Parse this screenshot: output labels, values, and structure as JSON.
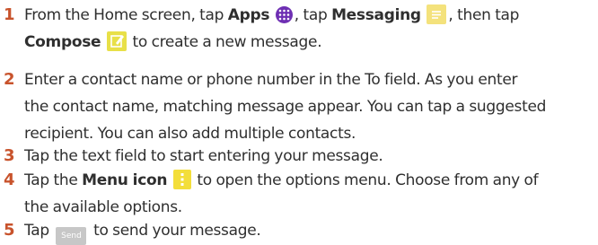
{
  "steps": [
    {
      "num": "1",
      "lines": [
        [
          "From the Home screen, tap ",
          "Apps",
          ", tap ",
          "Messaging",
          ", then tap"
        ],
        [
          "Compose",
          " to create a new message."
        ]
      ]
    },
    {
      "num": "2",
      "lines": [
        "Enter a contact name or phone number in the To field. As you enter",
        "the contact name, matching message appear. You can tap a suggested",
        "recipient. You can also add multiple contacts."
      ]
    },
    {
      "num": "3",
      "lines": [
        "Tap the text field to start entering your message."
      ]
    },
    {
      "num": "4",
      "lines": [
        [
          "Tap the ",
          "Menu icon",
          " to open the options menu. Choose from any of"
        ],
        "the available options."
      ]
    },
    {
      "num": "5",
      "lines": [
        [
          "Tap ",
          "Send",
          " to send your message."
        ]
      ]
    }
  ],
  "icons": {
    "apps": "apps-icon",
    "messaging": "messaging-icon",
    "compose": "compose-icon",
    "menu": "menu-icon"
  },
  "colors": {
    "step_number": "#c8532c",
    "text": "#2f2f2f",
    "apps_icon": "#6e2fb3",
    "messaging_icon": "#f4e27c",
    "compose_icon": "#e8e048",
    "menu_icon": "#f3de3a",
    "send_button": "#c7c7c7"
  }
}
